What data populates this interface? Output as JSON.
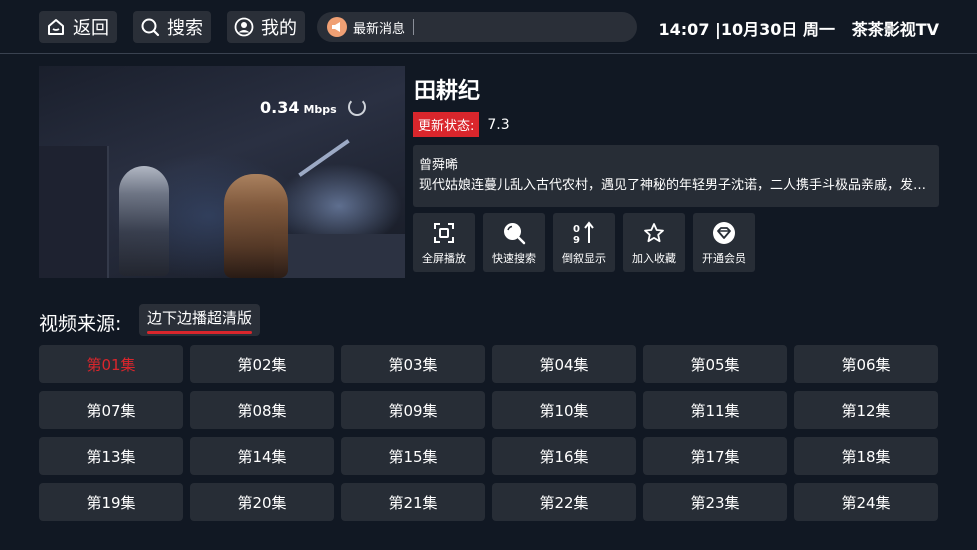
{
  "topbar": {
    "back_label": "返回",
    "search_label": "搜索",
    "mine_label": "我的",
    "news_label": "最新消息",
    "clock": "14:07 |10月30日 周一",
    "app_name": "茶茶影视TV"
  },
  "player": {
    "speed_value": "0.34",
    "speed_unit": "Mbps"
  },
  "detail": {
    "title": "田耕纪",
    "status_label": "更新状态:",
    "status_value": "7.3",
    "cast": "曾舜晞",
    "synopsis": "现代姑娘连蔓儿乱入古代农村，遇见了神秘的年轻男子沈诺，二人携手斗极品亲戚，发家致富"
  },
  "actions": [
    {
      "label": "全屏播放",
      "icon": "fullscreen-icon"
    },
    {
      "label": "快速搜索",
      "icon": "search-icon"
    },
    {
      "label": "倒叙显示",
      "icon": "sort-icon"
    },
    {
      "label": "加入收藏",
      "icon": "star-icon"
    },
    {
      "label": "开通会员",
      "icon": "vip-icon"
    }
  ],
  "source": {
    "label": "视频来源:",
    "selected": "边下边播超清版"
  },
  "episodes": [
    "第01集",
    "第02集",
    "第03集",
    "第04集",
    "第05集",
    "第06集",
    "第07集",
    "第08集",
    "第09集",
    "第10集",
    "第11集",
    "第12集",
    "第13集",
    "第14集",
    "第15集",
    "第16集",
    "第17集",
    "第18集",
    "第19集",
    "第20集",
    "第21集",
    "第22集",
    "第23集",
    "第24集"
  ],
  "colors": {
    "accent": "#d9262c",
    "background": "#111823",
    "tile": "#272d36"
  }
}
